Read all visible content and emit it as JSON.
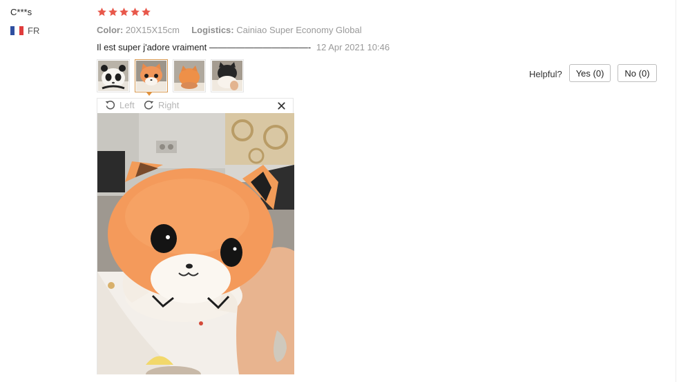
{
  "reviewer": {
    "name": "C***s",
    "country_code": "FR",
    "flag_colors": [
      "#2f4fa0",
      "#ffffff",
      "#e03c3c"
    ]
  },
  "rating": {
    "stars": 5,
    "max": 5,
    "color": "#e8584b"
  },
  "attributes": {
    "color_label": "Color:",
    "color_value": "20X15X15cm",
    "logistics_label": "Logistics:",
    "logistics_value": "Cainiao Super Economy Global"
  },
  "review": {
    "text": "Il est super j'adore vraiment ———————————-",
    "date": "12 Apr 2021 10:46"
  },
  "thumbnails": [
    {
      "icon": "plush-panda-photo-icon",
      "active": false
    },
    {
      "icon": "plush-fox-photo-icon",
      "active": true
    },
    {
      "icon": "plush-fox-back-photo-icon",
      "active": false
    },
    {
      "icon": "plush-black-cat-photo-icon",
      "active": false
    }
  ],
  "helpful": {
    "label": "Helpful?",
    "yes_label": "Yes (0)",
    "no_label": "No (0)"
  },
  "viewer": {
    "rotate_left_label": "Left",
    "rotate_right_label": "Right",
    "close_icon": "close-icon",
    "accent_color": "#e2913c"
  }
}
